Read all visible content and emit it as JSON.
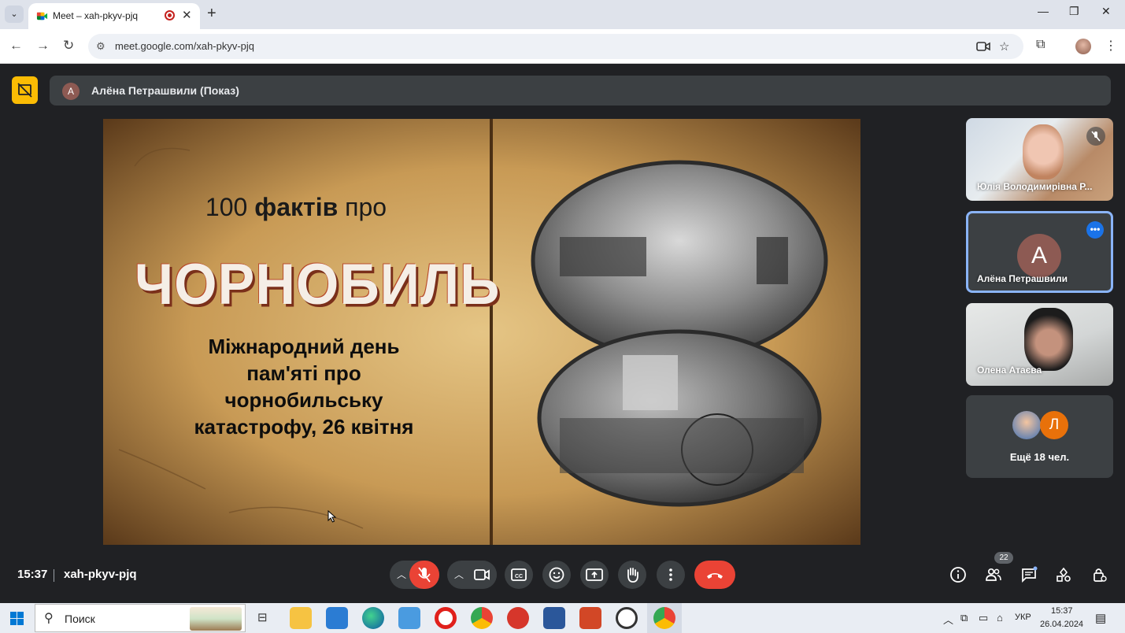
{
  "browser": {
    "tab_title": "Meet – xah-pkyv-pjq",
    "url": "meet.google.com/xah-pkyv-pjq"
  },
  "meet": {
    "presenter_initial": "А",
    "presenter_label": "Алёна Петрашвили (Показ)",
    "slide": {
      "line1_normal_a": "100 ",
      "line1_bold": "фактів",
      "line1_normal_b": " про",
      "title_big": "ЧОРНОБИЛЬ",
      "subtitle_lines": [
        "Міжнародний день",
        "пам'яті про",
        "чорнобильську",
        "катастрофу, 26 квітня"
      ]
    },
    "tiles": [
      {
        "name": "Юлія Володимирівна Р..."
      },
      {
        "name": "Алёна Петрашвили",
        "initial": "A"
      },
      {
        "name": "Олена Атаєва"
      },
      {
        "name": "Ещё 18 чел.",
        "initial": "Л"
      }
    ],
    "time": "15:37",
    "meeting_code": "xah-pkyv-pjq",
    "participants_count": "22"
  },
  "taskbar": {
    "search_placeholder": "Поиск",
    "lang": "УКР",
    "clock_time": "15:37",
    "clock_date": "26.04.2024"
  },
  "colors": {
    "meet_bg": "#202124",
    "end_call": "#ea4335",
    "present_accent": "#fbbc04",
    "tile_highlight": "#8ab4f8"
  }
}
